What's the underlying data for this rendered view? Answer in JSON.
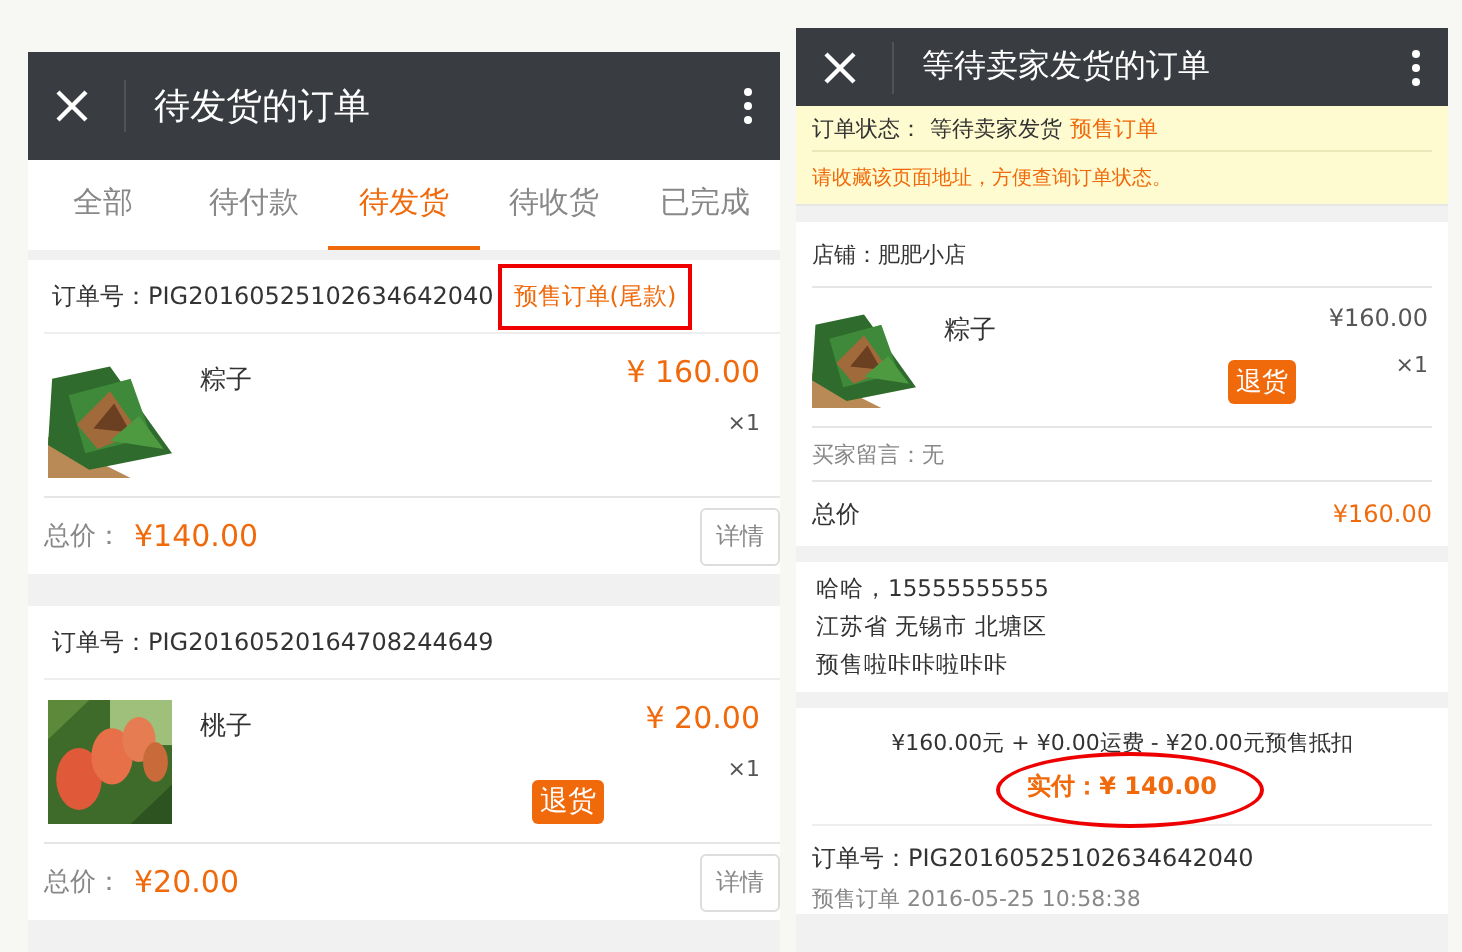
{
  "left": {
    "title": "待发货的订单",
    "tabs": [
      {
        "label": "全部",
        "selected": false
      },
      {
        "label": "待付款",
        "selected": false
      },
      {
        "label": "待发货",
        "selected": true
      },
      {
        "label": "待收货",
        "selected": false
      },
      {
        "label": "已完成",
        "selected": false
      }
    ],
    "orders": [
      {
        "order_no": "订单号：PIG20160525102634642040",
        "tag": "预售订单(尾款)",
        "highlighted": true,
        "item": {
          "kind": "zongzi",
          "name": "粽子",
          "price": "¥ 160.00",
          "qty": "×1"
        },
        "total_label": "总价：",
        "total": "¥140.00",
        "detail_button": "详情"
      },
      {
        "order_no": "订单号：PIG20160520164708244649",
        "item": {
          "kind": "peach",
          "name": "桃子",
          "price": "¥ 20.00",
          "qty": "×1",
          "return_button": "退货"
        },
        "total_label": "总价：",
        "total": "¥20.00",
        "detail_button": "详情"
      }
    ]
  },
  "right": {
    "title": "等待卖家发货的订单",
    "status_label": "订单状态：",
    "status": "等待卖家发货",
    "status_tag": "预售订单",
    "notice": "请收藏该页面地址，方便查询订单状态。",
    "shop": "店铺：肥肥小店",
    "item": {
      "kind": "zongzi",
      "name": "粽子",
      "price": "¥160.00",
      "qty": "×1",
      "return_button": "退货"
    },
    "buyer_message": "买家留言：无",
    "total_label": "总价",
    "total": "¥160.00",
    "address": [
      "哈哈，15555555555",
      "江苏省 无锡市 北塘区",
      "预售啦咔咔啦咔咔"
    ],
    "summary": "¥160.00元 + ¥0.00运费 - ¥20.00元预售抵扣",
    "paid": "实付：¥ 140.00",
    "paid_highlighted": true,
    "order_no": "订单号：PIG20160525102634642040",
    "order_time": "预售订单 2016-05-25 10:58:38"
  }
}
